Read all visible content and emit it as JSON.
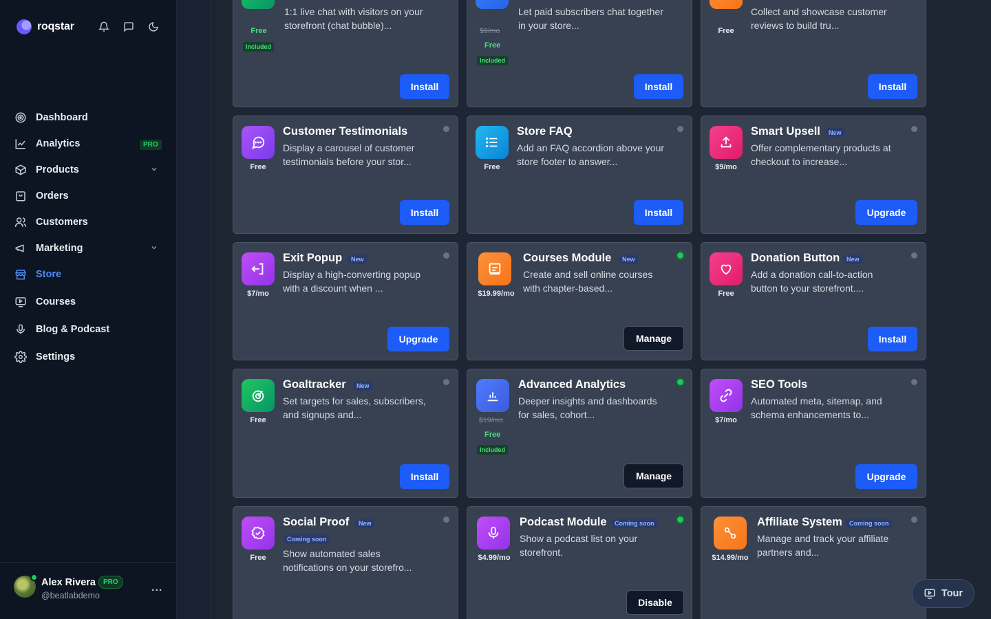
{
  "brand": {
    "name": "roqstar"
  },
  "icons": {
    "notifications": "bell-icon",
    "messages": "chat-icon",
    "theme": "moon-icon"
  },
  "nav": [
    {
      "label": "Dashboard",
      "icon": "target-icon"
    },
    {
      "label": "Analytics",
      "icon": "chart-line-icon",
      "badge": "PRO"
    },
    {
      "label": "Products",
      "icon": "box-icon"
    },
    {
      "label": "Orders",
      "icon": "bag-icon"
    },
    {
      "label": "Customers",
      "icon": "users-icon"
    },
    {
      "label": "Marketing",
      "icon": "megaphone-icon"
    },
    {
      "label": "Store",
      "icon": "store-icon",
      "active": true
    },
    {
      "label": "Courses",
      "icon": "monitor-icon"
    },
    {
      "label": "Blog & Podcast",
      "icon": "mic-icon"
    },
    {
      "label": "Settings",
      "icon": "gear-icon"
    }
  ],
  "user": {
    "name": "Alex Rivera",
    "badge": "PRO",
    "handle": "@beatlabdemo",
    "more": "..."
  },
  "tour": {
    "label": "Tour"
  },
  "cards": {
    "live_chat": {
      "desc": "1:1 live chat with visitors on your storefront (chat bubble)...",
      "price": "Free",
      "included": "Included",
      "button": "Install"
    },
    "members_chat": {
      "desc": "Let paid subscribers chat together in your store...",
      "old_price": "$9/mo",
      "price": "Free",
      "included": "Included",
      "button": "Install"
    },
    "reviews": {
      "desc": "Collect and showcase customer reviews to build tru...",
      "price": "Free",
      "button": "Install"
    },
    "testimonials": {
      "title": "Customer Testimonials",
      "desc": "Display a carousel of customer testimonials before your stor...",
      "price": "Free",
      "button": "Install"
    },
    "faq": {
      "title": "Store FAQ",
      "desc": "Add an FAQ accordion above your store footer to answer...",
      "price": "Free",
      "button": "Install"
    },
    "upsell": {
      "title": "Smart Upsell",
      "badge": "New",
      "desc": "Offer complementary products at checkout to increase...",
      "price": "$9/mo",
      "button": "Upgrade"
    },
    "exit_popup": {
      "title": "Exit Popup",
      "badge": "New",
      "desc": "Display a high-converting popup with a discount when ...",
      "price": "$7/mo",
      "button": "Upgrade"
    },
    "courses": {
      "title": "Courses Module",
      "badge": "New",
      "desc": "Create and sell online courses with chapter-based...",
      "price": "$19.99/mo",
      "button": "Manage"
    },
    "donation": {
      "title": "Donation Button",
      "badge": "New",
      "desc": "Add a donation call-to-action button to your storefront....",
      "price": "Free",
      "button": "Install"
    },
    "goaltracker": {
      "title": "Goaltracker",
      "badge": "New",
      "desc": "Set targets for sales, subscribers, and signups and...",
      "price": "Free",
      "button": "Install"
    },
    "analytics": {
      "title": "Advanced Analytics",
      "desc": "Deeper insights and dashboards for sales, cohort...",
      "old_price": "$19/mo",
      "price": "Free",
      "included": "Included",
      "button": "Manage"
    },
    "seo": {
      "title": "SEO Tools",
      "desc": "Automated meta, sitemap, and schema enhancements to...",
      "price": "$7/mo",
      "button": "Upgrade"
    },
    "social_proof": {
      "title": "Social Proof",
      "badge": "New",
      "soon": "Coming soon",
      "desc": "Show automated sales notifications on your storefro...",
      "price": "Free"
    },
    "podcast": {
      "title": "Podcast Module",
      "soon": "Coming soon",
      "desc": "Show a podcast list on your storefront.",
      "price": "$4.99/mo",
      "button": "Disable"
    },
    "affiliate": {
      "title": "Affiliate System",
      "soon": "Coming soon",
      "desc": "Manage and track your affiliate partners and...",
      "price": "$14.99/mo"
    }
  }
}
